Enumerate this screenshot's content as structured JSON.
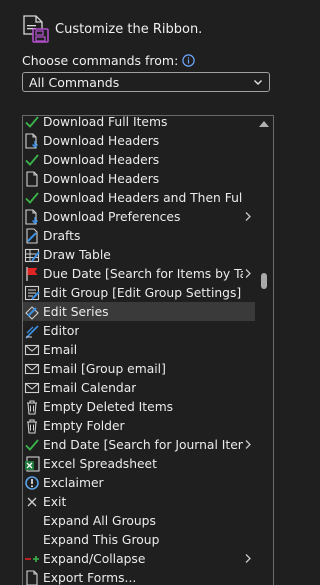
{
  "header": {
    "title": "Customize the Ribbon."
  },
  "chooser": {
    "label": "Choose commands from:",
    "selected": "All Commands"
  },
  "commands": [
    {
      "label": "Download Full Items",
      "icon": "check-green-icon"
    },
    {
      "label": "Download Headers",
      "icon": "download-page-icon"
    },
    {
      "label": "Download Headers",
      "icon": "check-green-icon"
    },
    {
      "label": "Download Headers",
      "icon": "page-icon"
    },
    {
      "label": "Download Headers and Then Full...",
      "icon": "check-green-icon"
    },
    {
      "label": "Download Preferences",
      "icon": "download-page-icon",
      "submenu": true
    },
    {
      "label": "Drafts",
      "icon": "drafts-icon"
    },
    {
      "label": "Draw Table",
      "icon": "draw-table-icon"
    },
    {
      "label": "Due Date [Search for Items by Tas...",
      "icon": "red-flag-icon",
      "submenu": true
    },
    {
      "label": "Edit Group [Edit Group Settings]",
      "icon": "edit-group-icon"
    },
    {
      "label": "Edit Series",
      "icon": "edit-series-icon",
      "selected": true
    },
    {
      "label": "Editor",
      "icon": "editor-icon"
    },
    {
      "label": "Email",
      "icon": "envelope-icon"
    },
    {
      "label": "Email [Group email]",
      "icon": "envelope-icon"
    },
    {
      "label": "Email Calendar",
      "icon": "envelope-icon"
    },
    {
      "label": "Empty Deleted Items",
      "icon": "trash-icon"
    },
    {
      "label": "Empty Folder",
      "icon": "trash-icon"
    },
    {
      "label": "End Date [Search for Journal Items...",
      "icon": "check-green-icon",
      "submenu": true
    },
    {
      "label": "Excel Spreadsheet",
      "icon": "excel-icon"
    },
    {
      "label": "Exclaimer",
      "icon": "exclaimer-icon"
    },
    {
      "label": "Exit",
      "icon": "close-x-icon"
    },
    {
      "label": "Expand All Groups",
      "icon": "none"
    },
    {
      "label": "Expand This Group",
      "icon": "none"
    },
    {
      "label": "Expand/Collapse",
      "icon": "expand-collapse-icon",
      "submenu": true
    },
    {
      "label": "Export Forms...",
      "icon": "page-icon"
    }
  ]
}
